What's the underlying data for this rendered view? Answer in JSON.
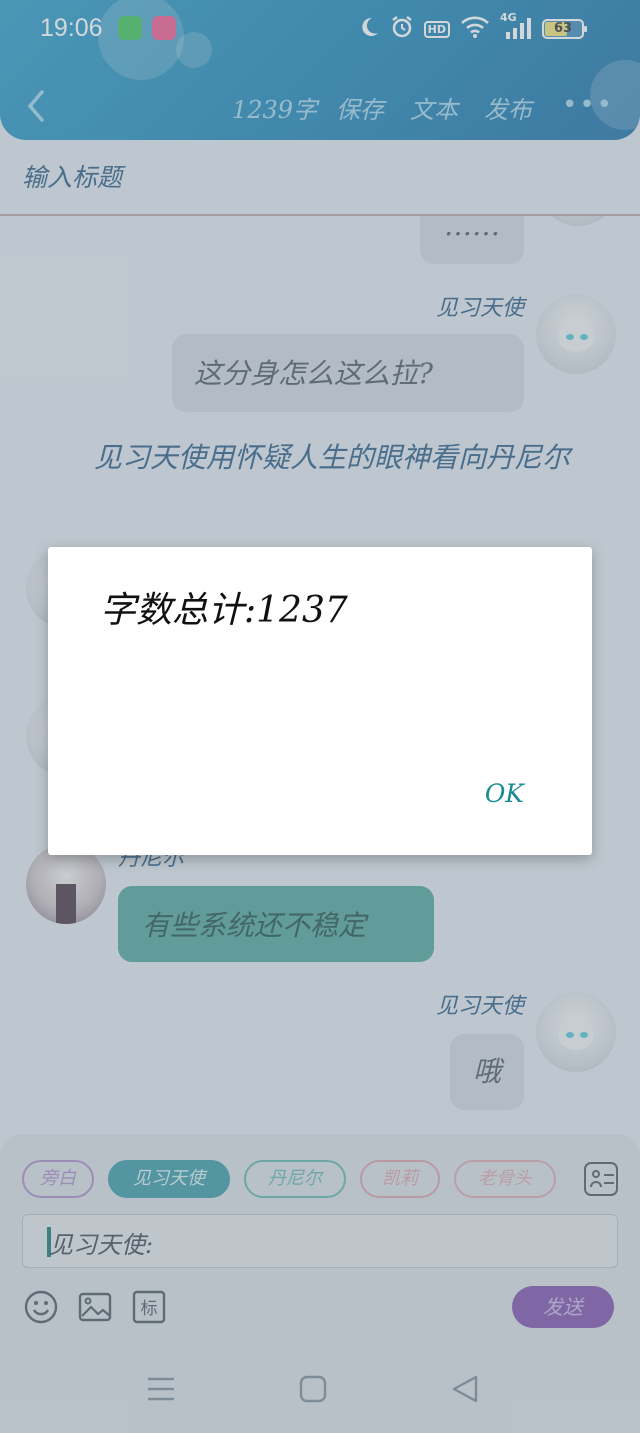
{
  "status_bar": {
    "time": "19:06",
    "hd": "HD",
    "network": "4G",
    "battery": "63",
    "battery_level": 0.63
  },
  "toolbar": {
    "word_count_label": "1239字",
    "save_label": "保存",
    "text_label": "文本",
    "publish_label": "发布",
    "more_label": "•••"
  },
  "title_field": {
    "placeholder": "输入标题"
  },
  "chat": {
    "messages": [
      {
        "speaker": "",
        "text": "……",
        "side": "right"
      },
      {
        "speaker": "见习天使",
        "text": "这分身怎么这么拉?",
        "side": "right"
      },
      {
        "speaker": "",
        "text": "见习天使用怀疑人生的眼神看向丹尼尔",
        "side": "narration"
      },
      {
        "speaker": "丹尼尔",
        "text": "有些系统还不稳定",
        "side": "left"
      },
      {
        "speaker": "见习天使",
        "text": "哦",
        "side": "right"
      }
    ]
  },
  "dialog": {
    "message": "字数总计:1237",
    "ok_label": "OK"
  },
  "input_panel": {
    "roles": [
      "旁白",
      "见习天使",
      "丹尼尔",
      "凯莉",
      "老骨头"
    ],
    "input_prefix": "见习天使:",
    "send_label": "发送"
  },
  "colors": {
    "header": "#1f86b8",
    "accent_teal": "#52a59d",
    "send_purple": "#7d54ad",
    "dialog_ok": "#1a8b93"
  }
}
